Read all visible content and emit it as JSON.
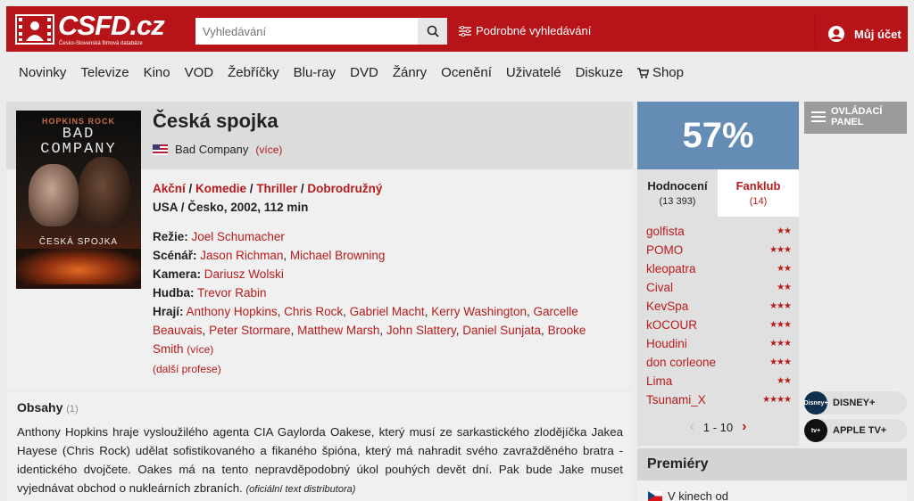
{
  "header": {
    "logo_text": "CSFD.cz",
    "logo_subtitle": "Česko-Slovenská filmová databáze",
    "search_placeholder": "Vyhledávání",
    "advanced_search": "Podrobné vyhledávání",
    "account": "Můj účet"
  },
  "nav": [
    "Novinky",
    "Televize",
    "Kino",
    "VOD",
    "Žebříčky",
    "Blu-ray",
    "DVD",
    "Žánry",
    "Ocenění",
    "Uživatelé",
    "Diskuze",
    "Shop"
  ],
  "film": {
    "poster": {
      "top": "HOPKINS ROCK",
      "title_line1": "BAD",
      "title_line2": "COMPANY",
      "footer": "ČESKÁ SPOJKA"
    },
    "title": "Česká spojka",
    "original_title": "Bad Company",
    "more": "(více)",
    "genres": [
      "Akční",
      "Komedie",
      "Thriller",
      "Dobrodružný"
    ],
    "origin": "USA / Česko, 2002, 112 min",
    "crew": {
      "rezie_label": "Režie:",
      "rezie": [
        "Joel Schumacher"
      ],
      "scenar_label": "Scénář:",
      "scenar": [
        "Jason Richman",
        "Michael Browning"
      ],
      "kamera_label": "Kamera:",
      "kamera": [
        "Dariusz Wolski"
      ],
      "hudba_label": "Hudba:",
      "hudba": [
        "Trevor Rabin"
      ],
      "hraji_label": "Hrají:",
      "hraji": [
        "Anthony Hopkins",
        "Chris Rock",
        "Gabriel Macht",
        "Kerry Washington",
        "Garcelle Beauvais",
        "Peter Stormare",
        "Matthew Marsh",
        "John Slattery",
        "Daniel Sunjata",
        "Brooke Smith"
      ],
      "more": "(více)",
      "other": "(další profese)"
    }
  },
  "plot": {
    "title": "Obsahy",
    "count": "(1)",
    "text": "Anthony Hopkins hraje vysloužilého agenta CIA Gaylorda Oakese, který musí ze sarkastického zlodějíčka Jakea Hayese (Chris Rock) udělat sofistikovaného a fikaného špióna, který má nahradit svého zavražděného bratra - identického dvojčete. Oakes má na tento nepravděpodobný úkol pouhých devět dní. Pak bude Jake muset vyjednávat obchod o nukleárních zbraních.",
    "source": "(oficiální text distributora)"
  },
  "rating": {
    "percent": "57%",
    "tab_ratings": "Hodnocení",
    "tab_ratings_count": "(13 393)",
    "tab_fanclub": "Fanklub",
    "tab_fanclub_count": "(14)",
    "users": [
      {
        "name": "golfista",
        "stars": "★★"
      },
      {
        "name": "POMO",
        "stars": "★★★"
      },
      {
        "name": "kleopatra",
        "stars": "★★"
      },
      {
        "name": "Cival",
        "stars": "★★"
      },
      {
        "name": "KevSpa",
        "stars": "★★★"
      },
      {
        "name": "kOCOUR",
        "stars": "★★★"
      },
      {
        "name": "Houdini",
        "stars": "★★★"
      },
      {
        "name": "don corleone",
        "stars": "★★★"
      },
      {
        "name": "Lima",
        "stars": "★★"
      },
      {
        "name": "Tsunami_X",
        "stars": "★★★★"
      }
    ],
    "pager": "1 - 10"
  },
  "sidebar": {
    "control_panel_line1": "OVLÁDACÍ",
    "control_panel_line2": "PANEL",
    "disney_icon": "Disney+",
    "disney": "DISNEY+",
    "appletv_icon": "tv+",
    "appletv": "APPLE TV+"
  },
  "premiery": {
    "title": "Premiéry",
    "item": "V kinech od"
  },
  "colors": {
    "brand_red": "#b71419",
    "rating_blue": "#658cb4"
  }
}
